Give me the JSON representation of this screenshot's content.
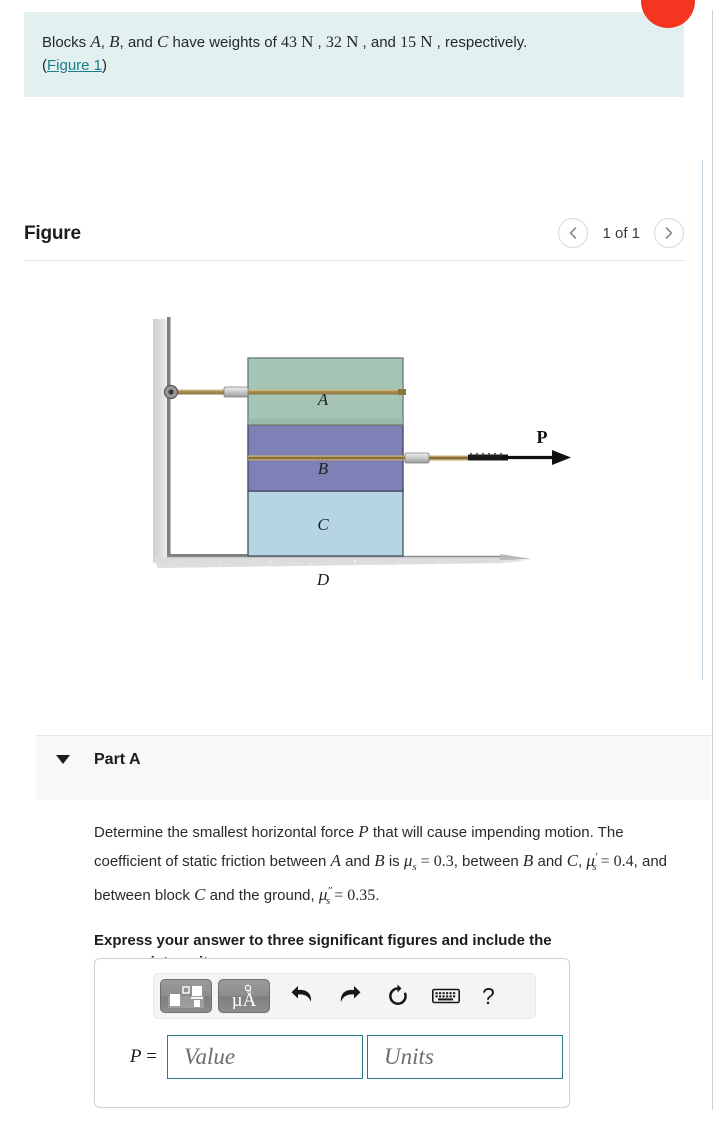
{
  "statement": {
    "prefix": "Blocks ",
    "block_a": "A",
    "sep1": ", ",
    "block_b": "B",
    "sep2": ", and ",
    "block_c": "C",
    "mid": " have weights of ",
    "w1": "43",
    "unit1": "N",
    "sep3": " , ",
    "w2": "32",
    "unit2": "N",
    "sep4": " , and ",
    "w3": "15",
    "unit3": "N",
    "suffix": " , respectively.",
    "paren_open": "(",
    "figure_link": "Figure 1",
    "paren_close": ")"
  },
  "figure": {
    "title": "Figure",
    "count_label": "1 of 1",
    "prev_icon": "chevron-left-icon",
    "next_icon": "chevron-right-icon",
    "labels": {
      "block_a": "A",
      "block_b": "B",
      "block_c": "C",
      "ground": "D",
      "force": "P"
    },
    "colors": {
      "block_a": "#a4c5b5",
      "block_b": "#7f80b6",
      "block_c": "#b6d5e4",
      "rope": "#a08a4e",
      "wall": "#d8d8d8",
      "arrow": "#111111"
    }
  },
  "part": {
    "toggle_icon": "triangle-down-icon",
    "title": "Part A"
  },
  "question": {
    "line1_a": "Determine the smallest horizontal force ",
    "sym_p": "P",
    "line1_b": " that will cause impending motion. The coefficient of static friction between ",
    "sym_a": "A",
    "line1_c": " and ",
    "sym_b": "B",
    "line1_d": " is ",
    "mu_s": "μ",
    "mu_s_sub": "s",
    "eq1": " = 0.3",
    "line1_e": ", between ",
    "sym_b2": "B",
    "line1_f": " and ",
    "sym_c": "C",
    "line1_g": ", ",
    "mu_s_prime": "μ",
    "mu_s_prime_sup": "′",
    "mu_s_prime_sub": "s",
    "eq2": " = 0.4",
    "line1_h": ", and between block ",
    "sym_c2": "C",
    "line1_i": " and the ground, ",
    "mu_s_dprime": "μ",
    "mu_s_dprime_sup": "″",
    "mu_s_dprime_sub": "s",
    "eq3": " = 0.35",
    "line1_end": ".",
    "instruction": "Express your answer to three significant figures and include the appropriate units."
  },
  "answer": {
    "toolbar": {
      "template_icon": "math-template-icon",
      "units_icon": "micro-angstrom-units-icon",
      "units_label": "μÅ",
      "undo_icon": "undo-arrow-icon",
      "redo_icon": "redo-arrow-icon",
      "reset_icon": "reset-circular-arrow-icon",
      "keyboard_icon": "keyboard-icon",
      "help_icon": "question-mark-icon",
      "help_label": "?"
    },
    "label_var": "P",
    "label_eq": " =",
    "value_placeholder": "Value",
    "value_current": "",
    "units_placeholder": "Units",
    "units_current": ""
  },
  "theme": {
    "statement_bg": "#e2f1f0",
    "link_color": "#1d7c8c",
    "input_border": "#2b7b8c",
    "badge_color": "#f4351f",
    "band_bg": "#f8f8f8"
  }
}
